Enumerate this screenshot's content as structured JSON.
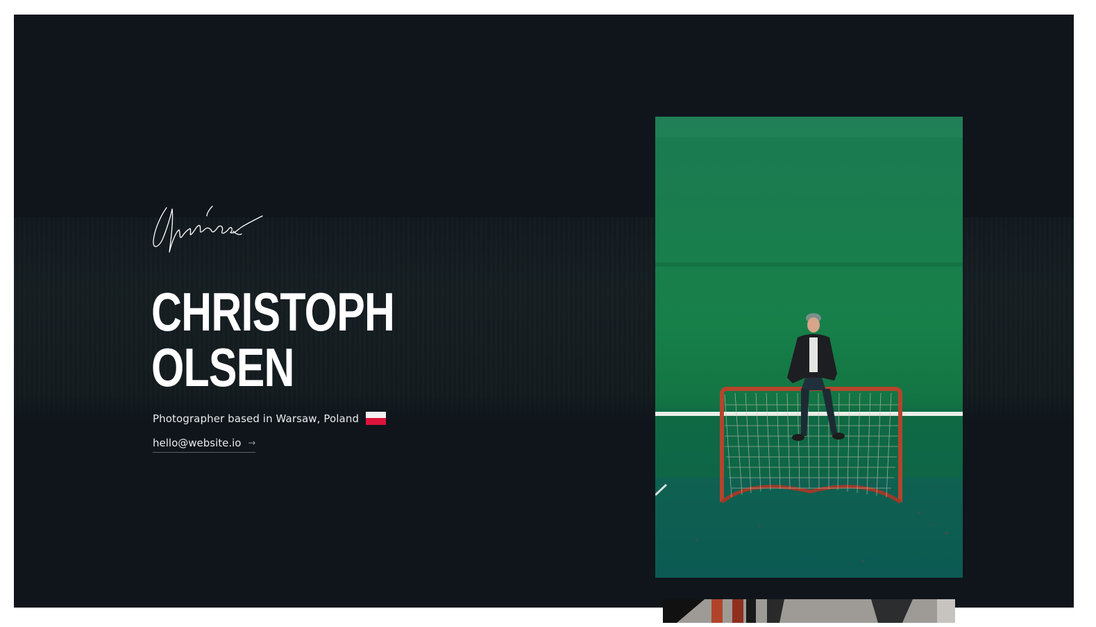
{
  "hero": {
    "name_line1": "CHRISTOPH",
    "name_line2": "OLSEN",
    "subtitle": "Photographer based in Warsaw, Poland",
    "email": "hello@website.io",
    "arrow": "→"
  },
  "icons": {
    "signature": "signature-logo",
    "flag": "poland-flag-icon",
    "arrow": "arrow-right-icon"
  },
  "colors": {
    "background": "#0f151b",
    "accent_green": "#1c7a52",
    "text": "#ffffff",
    "flag_red": "#dc143c",
    "flag_white": "#f2f2f2"
  },
  "photos": {
    "main_subject": "person sitting on hockey net in front of green wall",
    "second_subject": "partial photo with red figures"
  }
}
